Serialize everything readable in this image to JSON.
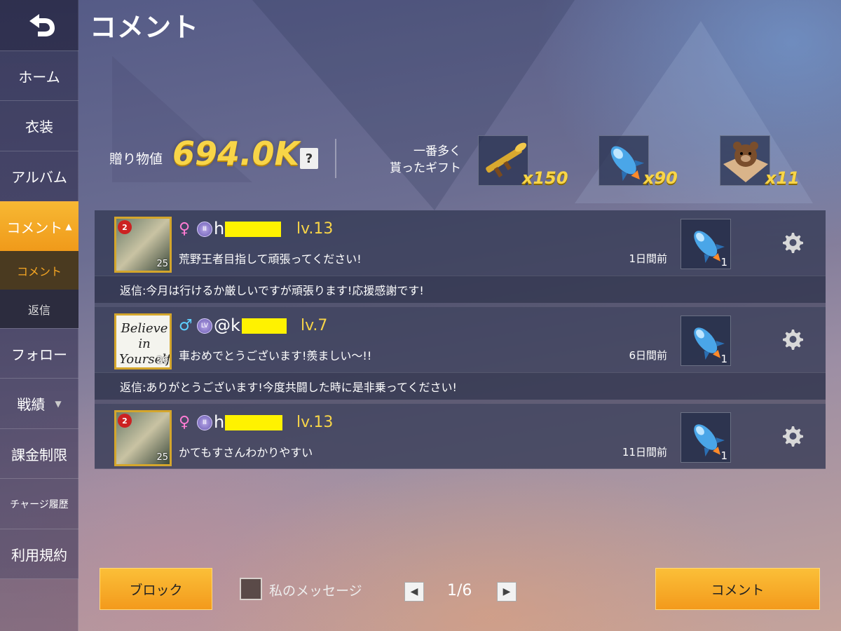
{
  "header": {
    "title": "コメント"
  },
  "sidebar": {
    "items": [
      {
        "label": "ホーム"
      },
      {
        "label": "衣装"
      },
      {
        "label": "アルバム"
      },
      {
        "label": "コメント",
        "caret": "▲"
      },
      {
        "label": "フォロー"
      },
      {
        "label": "戦績",
        "caret": "▼"
      },
      {
        "label": "課金制限"
      },
      {
        "label": "チャージ履歴"
      },
      {
        "label": "利用規約"
      }
    ],
    "subitems": [
      {
        "label": "コメント"
      },
      {
        "label": "返信"
      }
    ]
  },
  "gifts": {
    "label": "贈り物値",
    "value": "694.0K",
    "help": "?",
    "most_label_line1": "一番多く",
    "most_label_line2": "貰ったギフト",
    "top": [
      {
        "icon": "bazooka-icon",
        "count": "x150"
      },
      {
        "icon": "rocket-icon",
        "count": "x90"
      },
      {
        "icon": "teddy-bear-box-icon",
        "count": "x11"
      }
    ]
  },
  "comments": [
    {
      "avatar_badge": "2",
      "avatar_num": "25",
      "gender": "♀",
      "rank": "Ⅲ",
      "username": "h",
      "level": "lv.13",
      "text": "荒野王者目指して頑張ってください!",
      "time": "1日間前",
      "gift_count": "1",
      "reply": "返信:今月は行けるか厳しいですが頑張ります!応援感謝です!"
    },
    {
      "avatar_quote": "Believe in Yourself",
      "avatar_num": "26",
      "gender": "♂",
      "rank": "LV",
      "username": "@k",
      "level": "lv.7",
      "text": "車おめでとうございます!羨ましい〜!!",
      "time": "6日間前",
      "gift_count": "1",
      "reply": "返信:ありがとうございます!今度共闘した時に是非乗ってください!"
    },
    {
      "avatar_badge": "2",
      "avatar_num": "25",
      "gender": "♀",
      "rank": "Ⅲ",
      "username": "h",
      "level": "lv.13",
      "text": "かてもすさんわかりやすい",
      "time": "11日間前",
      "gift_count": "1"
    }
  ],
  "footer": {
    "block_label": "ブロック",
    "my_messages_label": "私のメッセージ",
    "page": "1/6",
    "prev": "◀",
    "next": "▶",
    "comment_label": "コメント"
  }
}
